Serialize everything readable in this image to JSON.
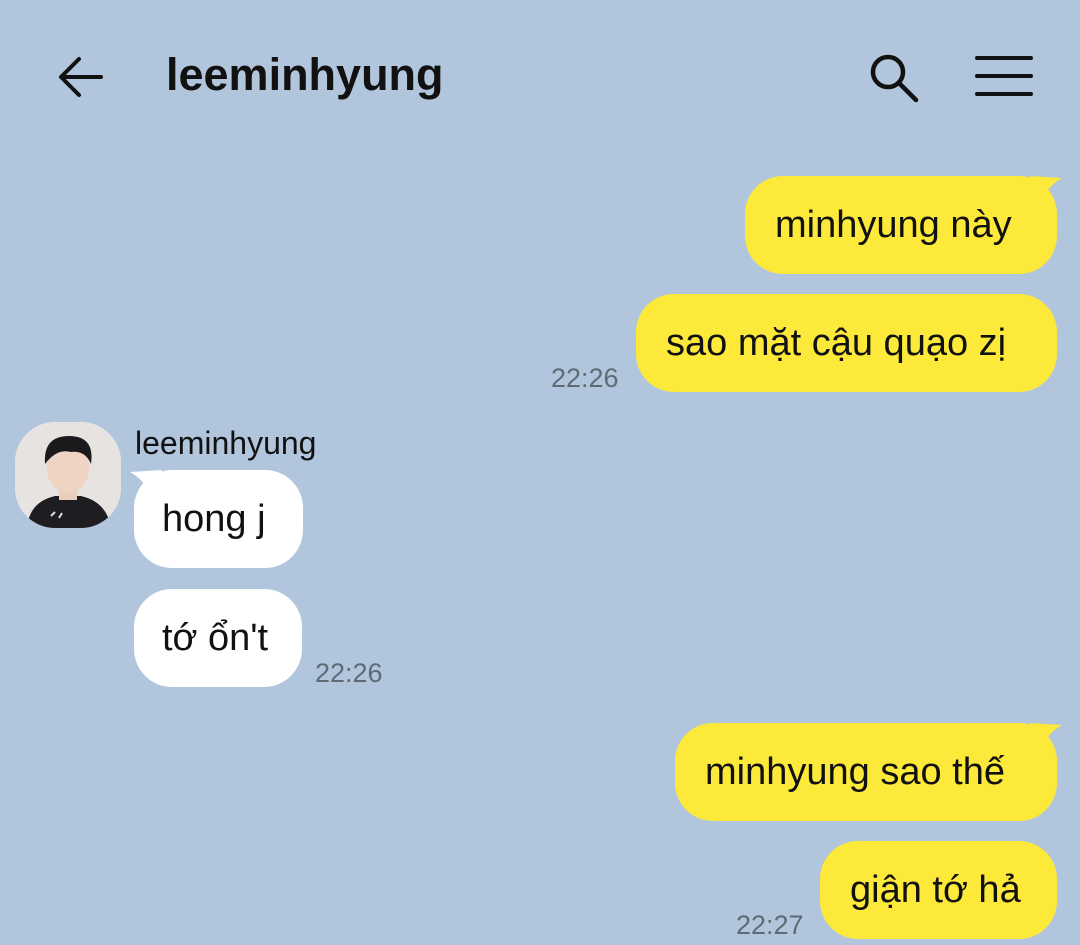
{
  "header": {
    "back_icon": "arrow-left-icon",
    "title": "leeminhyung",
    "search_icon": "search-icon",
    "menu_icon": "hamburger-menu-icon"
  },
  "colors": {
    "background": "#b1c6dc",
    "outgoing_bubble": "#fce93a",
    "incoming_bubble": "#ffffff",
    "timestamp": "#606a74"
  },
  "messages": {
    "out1": {
      "text": "minhyung này"
    },
    "out2": {
      "text": "sao mặt cậu quạo zị",
      "time": "22:26"
    },
    "sender_name": "leeminhyung",
    "in1": {
      "text": "hong j"
    },
    "in2": {
      "text": "tớ ổn't",
      "time": "22:26"
    },
    "out3": {
      "text": "minhyung sao thế"
    },
    "out4": {
      "text": "giận tớ hả",
      "time": "22:27"
    }
  }
}
